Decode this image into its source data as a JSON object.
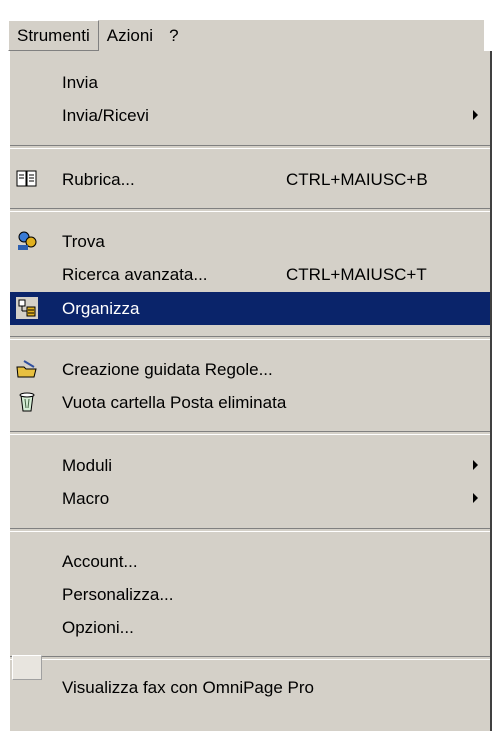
{
  "menubar": {
    "items": [
      {
        "label": "Strumenti"
      },
      {
        "label": "Azioni"
      },
      {
        "label": "?"
      }
    ]
  },
  "menu": {
    "items": [
      {
        "label": "Invia",
        "shortcut": "",
        "submenu": false
      },
      {
        "label": "Invia/Ricevi",
        "shortcut": "",
        "submenu": true
      },
      {
        "label": "Rubrica...",
        "shortcut": "CTRL+MAIUSC+B",
        "icon": "address-book-icon"
      },
      {
        "label": "Trova",
        "shortcut": "",
        "icon": "find-people-icon"
      },
      {
        "label": "Ricerca avanzata...",
        "shortcut": "CTRL+MAIUSC+T"
      },
      {
        "label": "Organizza",
        "shortcut": "",
        "icon": "organize-icon",
        "highlighted": true
      },
      {
        "label": "Creazione guidata Regole...",
        "shortcut": "",
        "icon": "rules-wizard-icon"
      },
      {
        "label": "Vuota cartella Posta eliminata",
        "shortcut": "",
        "icon": "empty-trash-icon"
      },
      {
        "label": "Moduli",
        "shortcut": "",
        "submenu": true
      },
      {
        "label": "Macro",
        "shortcut": "",
        "submenu": true
      },
      {
        "label": "Account...",
        "shortcut": ""
      },
      {
        "label": "Personalizza...",
        "shortcut": ""
      },
      {
        "label": "Opzioni...",
        "shortcut": ""
      },
      {
        "label": "Visualizza fax con OmniPage Pro",
        "shortcut": ""
      }
    ]
  },
  "colors": {
    "menu_bg": "#d4d0c8",
    "highlight": "#0a246a"
  }
}
